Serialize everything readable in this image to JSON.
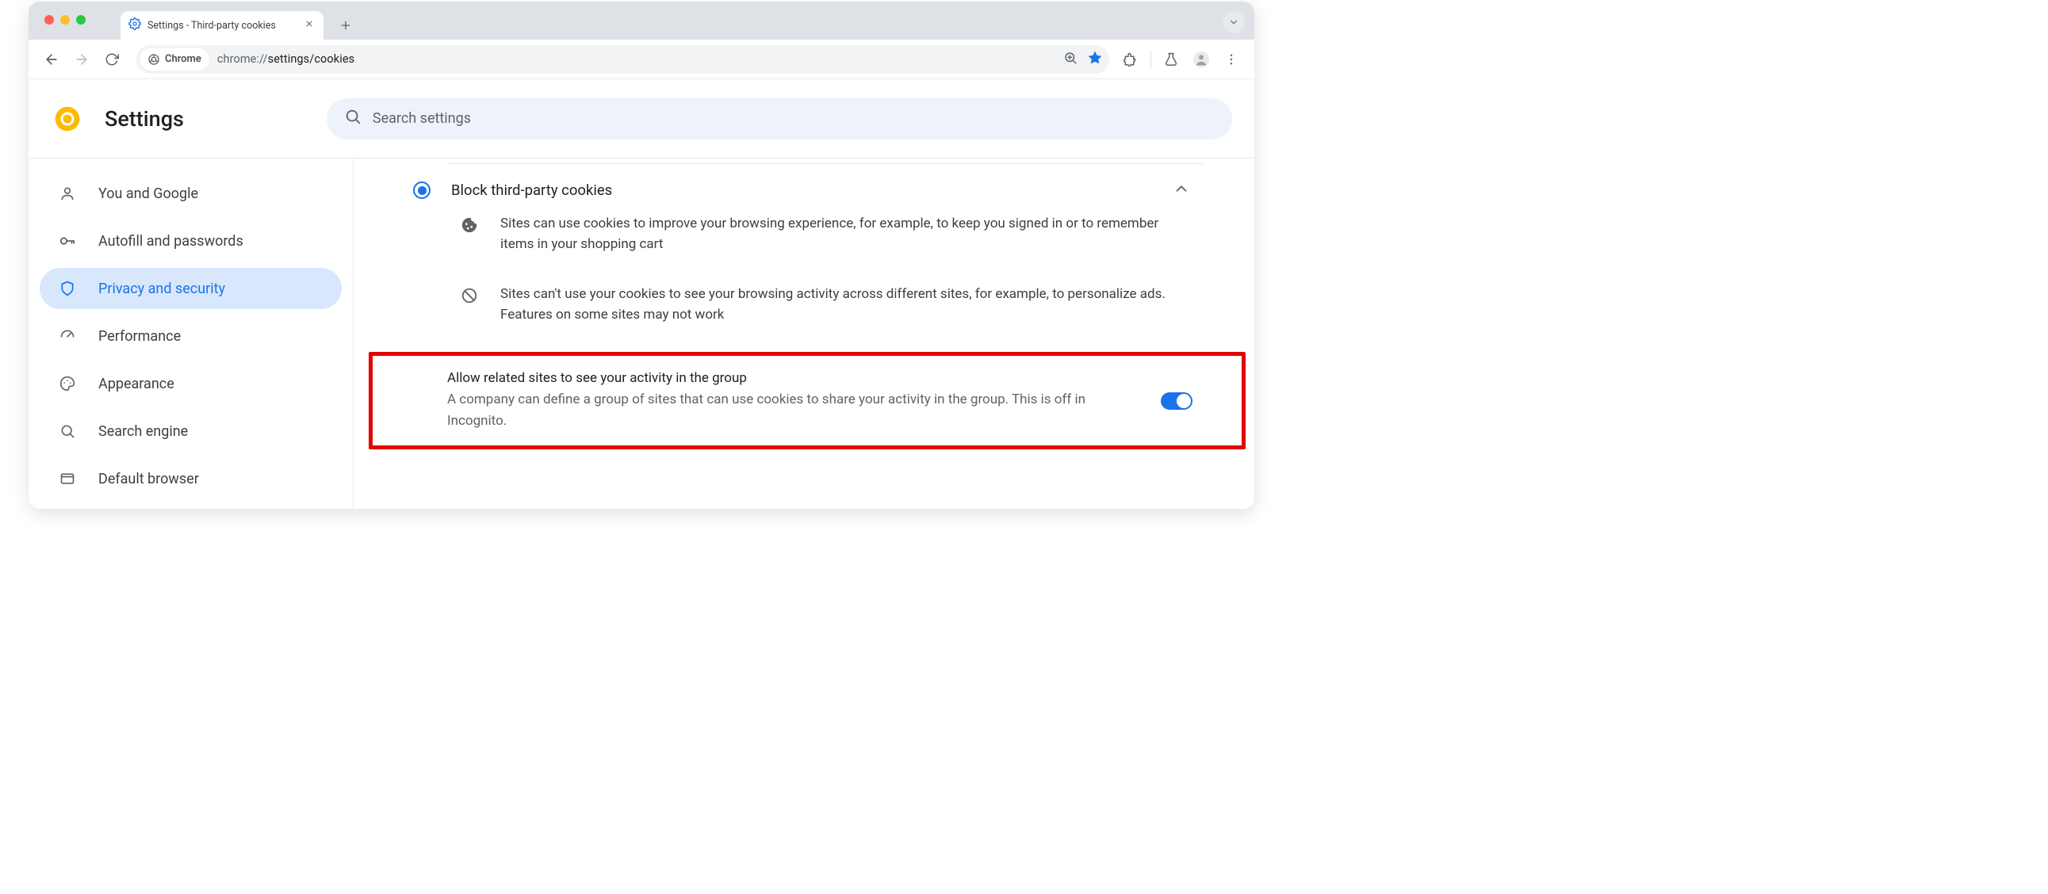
{
  "browser": {
    "tab_title": "Settings - Third-party cookies",
    "url_prefix": "chrome://",
    "url_rest": "settings/cookies",
    "chip_label": "Chrome"
  },
  "header": {
    "title": "Settings",
    "search_placeholder": "Search settings"
  },
  "sidebar": {
    "items": [
      {
        "label": "You and Google"
      },
      {
        "label": "Autofill and passwords"
      },
      {
        "label": "Privacy and security"
      },
      {
        "label": "Performance"
      },
      {
        "label": "Appearance"
      },
      {
        "label": "Search engine"
      },
      {
        "label": "Default browser"
      }
    ]
  },
  "panel": {
    "accordion_title": "Block third-party cookies",
    "desc1": "Sites can use cookies to improve your browsing experience, for example, to keep you signed in or to remember items in your shopping cart",
    "desc2": "Sites can't use your cookies to see your browsing activity across different sites, for example, to personalize ads. Features on some sites may not work",
    "toggle_title": "Allow related sites to see your activity in the group",
    "toggle_sub": "A company can define a group of sites that can use cookies to share your activity in the group. This is off in Incognito."
  }
}
